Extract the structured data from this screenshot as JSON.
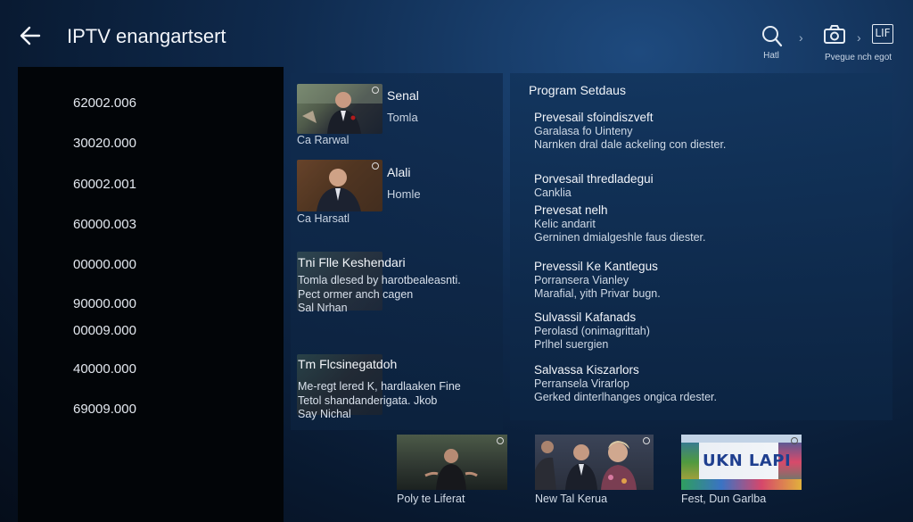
{
  "header": {
    "back_icon": "arrow-left-icon",
    "title": "IPTV enangartsert",
    "actions": [
      {
        "icon": "search-icon",
        "label": "Hatl"
      },
      {
        "icon": "camera-icon",
        "label": ""
      },
      {
        "icon": "lif-icon",
        "text": "LIF",
        "label": "Pvegue nch egot"
      }
    ]
  },
  "numbers": [
    "62002.006",
    "30020.000",
    "60002.001",
    "60000.003",
    "00000.000",
    "90000.000",
    "00009.000",
    "40000.000",
    "69009.000"
  ],
  "channels": [
    {
      "title": "Senal",
      "subtitle": "Tomla",
      "caption": "Ca Rarwal"
    },
    {
      "title": "Alali",
      "subtitle": "Homle",
      "caption": "Ca Harsatl"
    },
    {
      "title": "Tni Flle Keshendari",
      "lines": [
        "Tomla dlesed by harotbealeasnti.",
        "Pect ormer anch cagen",
        "Sal Nrhan"
      ]
    },
    {
      "title": "Tm Flcsinegatdoh",
      "lines": [
        "Me-regt lered K, hardlaaken Fine",
        "Tetol shandanderigata. Jkob",
        "Say Nichal"
      ]
    }
  ],
  "program": {
    "heading": "Program Setdaus",
    "entries": [
      {
        "title": "Prevesail sfoindiszveft",
        "lines": [
          "Garalasa fo Uinteny",
          "Narnken dral dale ackeling con diester."
        ]
      },
      {
        "title": "Porvesail thredladegui",
        "lines": [
          "Canklia"
        ]
      },
      {
        "title": "Prevesat nelh",
        "lines": [
          "Kelic andarit",
          "Gerninen dmialgeshle faus diester."
        ]
      },
      {
        "title": "Prevessil Ke Kantlegus",
        "lines": [
          "Porransera Vianley",
          "Marafial, yith Privar bugn."
        ]
      },
      {
        "title": "Sulvassil Kafanads",
        "lines": [
          "Perolasd (onimagrittah)",
          "Prlhel suergien"
        ]
      },
      {
        "title": "Salvassa Kiszarlors",
        "lines": [
          "Perransela Virarlop",
          "Gerked dinterlhanges ongica rdester."
        ]
      }
    ]
  },
  "bottom": [
    {
      "label": "Poly te Liferat"
    },
    {
      "label": "New Tal Kerua"
    },
    {
      "label": "Fest, Dun Garlba",
      "banner_text": "UKN LAPI"
    }
  ]
}
